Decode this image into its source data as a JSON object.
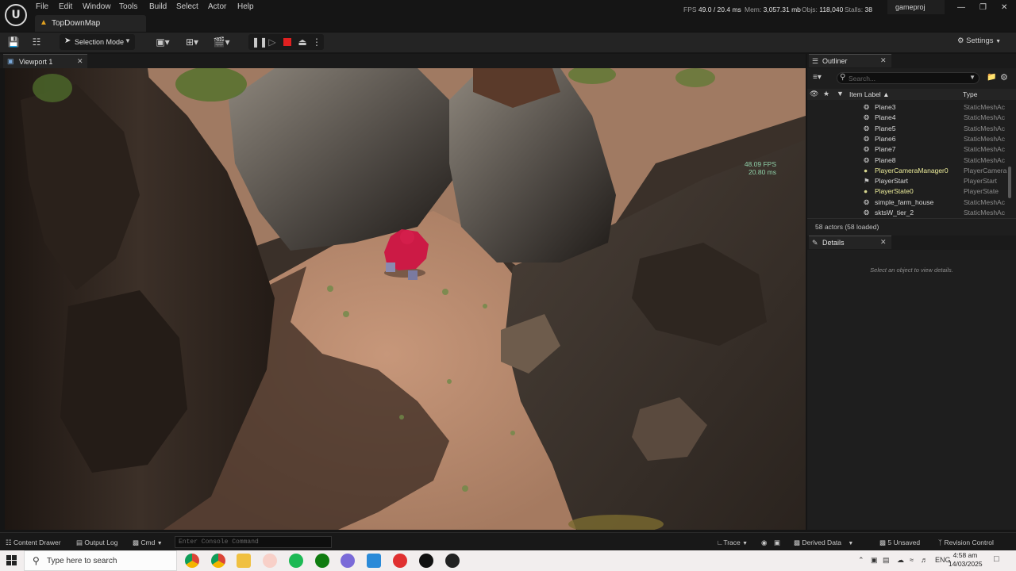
{
  "window": {
    "menu": [
      "File",
      "Edit",
      "Window",
      "Tools",
      "Build",
      "Select",
      "Actor",
      "Help"
    ],
    "map_tab": "TopDownMap",
    "stats": {
      "fps_label": "FPS",
      "fps_value": "49.0",
      "ms_value": "/ 20.4 ms",
      "mem_label": "Mem:",
      "mem_value": "3,057.31 mb",
      "objs_label": "Objs:",
      "objs_value": "118,040",
      "stalls_label": "Stalls:",
      "stalls_value": "38"
    },
    "project": "gameproj"
  },
  "toolbar": {
    "selection_mode": "Selection Mode",
    "settings": "Settings"
  },
  "viewport": {
    "tab": "Viewport 1",
    "fps_overlay": "48.09 FPS",
    "ms_overlay": "20.80 ms"
  },
  "outliner": {
    "tab": "Outliner",
    "search_placeholder": "Search...",
    "col_label": "Item Label",
    "col_type": "Type",
    "rows": [
      {
        "label": "Plane3",
        "type": "StaticMeshAc",
        "icon": "mesh"
      },
      {
        "label": "Plane4",
        "type": "StaticMeshAc",
        "icon": "mesh"
      },
      {
        "label": "Plane5",
        "type": "StaticMeshAc",
        "icon": "mesh"
      },
      {
        "label": "Plane6",
        "type": "StaticMeshAc",
        "icon": "mesh"
      },
      {
        "label": "Plane7",
        "type": "StaticMeshAc",
        "icon": "mesh"
      },
      {
        "label": "Plane8",
        "type": "StaticMeshAc",
        "icon": "mesh"
      },
      {
        "label": "PlayerCameraManager0",
        "type": "PlayerCamera",
        "icon": "actor",
        "highlight": true
      },
      {
        "label": "PlayerStart",
        "type": "PlayerStart",
        "icon": "flag"
      },
      {
        "label": "PlayerState0",
        "type": "PlayerState",
        "icon": "actor",
        "highlight": true
      },
      {
        "label": "simple_farm_house",
        "type": "StaticMeshAc",
        "icon": "mesh"
      },
      {
        "label": "sktsW_tier_2",
        "type": "StaticMeshAc",
        "icon": "mesh"
      }
    ],
    "footer": "58 actors (58 loaded)"
  },
  "details": {
    "tab": "Details",
    "hint": "Select an object to view details."
  },
  "bottombar": {
    "content_drawer": "Content Drawer",
    "output_log": "Output Log",
    "cmd": "Cmd",
    "console_placeholder": "Enter Console Command",
    "trace": "Trace",
    "derived_data": "Derived Data",
    "unsaved": "5 Unsaved",
    "revision_control": "Revision Control"
  },
  "taskbar": {
    "search": "Type here to search",
    "lang": "ENG",
    "time": "4:58 am",
    "date": "14/03/2025"
  }
}
